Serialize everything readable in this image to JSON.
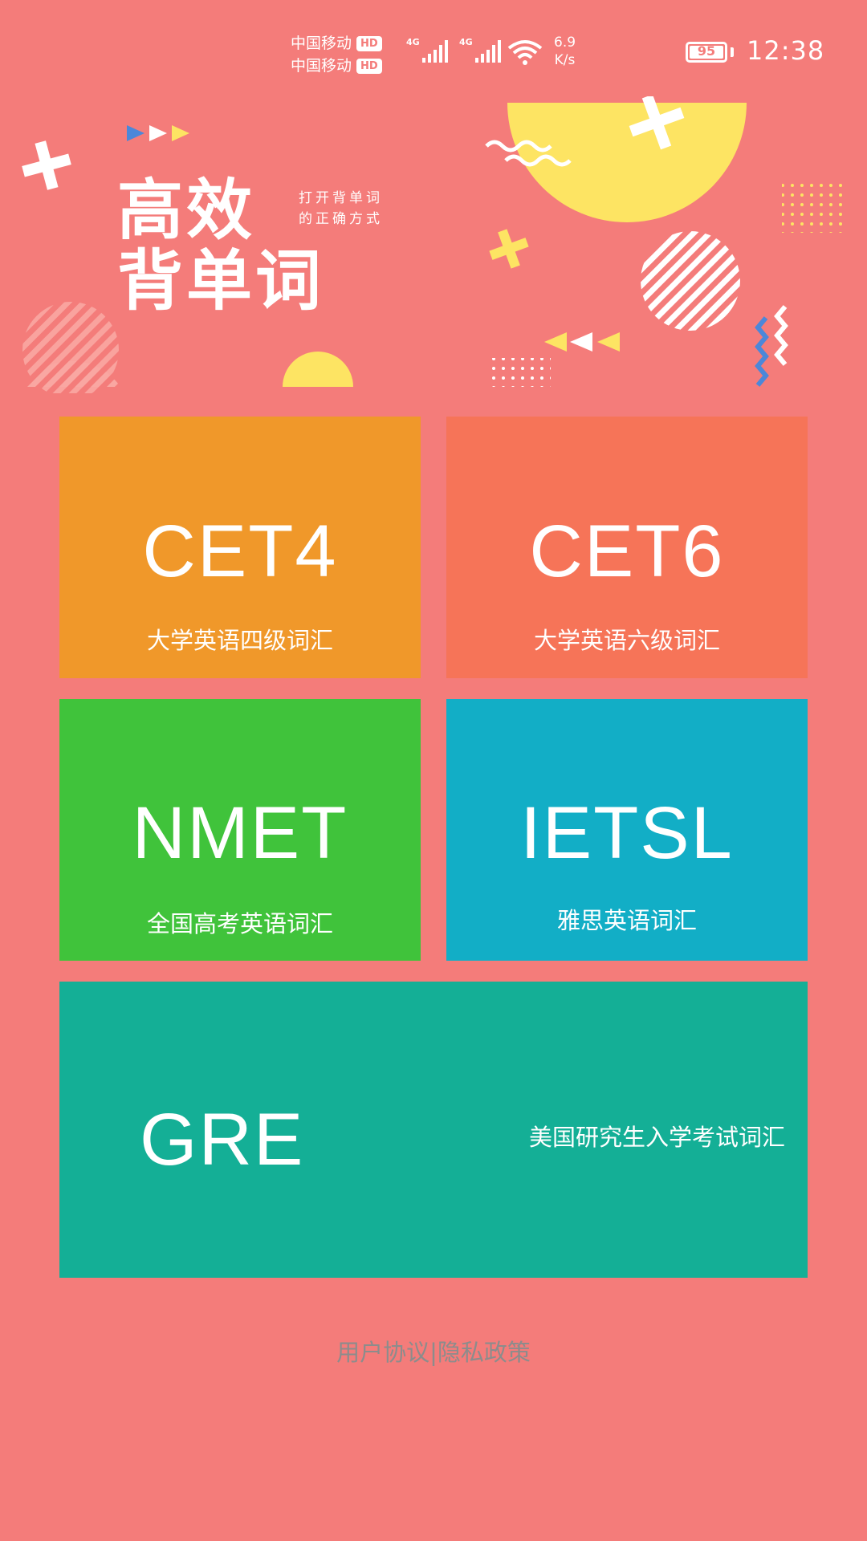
{
  "status_bar": {
    "carrier1": "中国移动",
    "carrier2": "中国移动",
    "hd_badge": "HD",
    "network1": "4G",
    "network2": "4G",
    "speed_value": "6.9",
    "speed_unit": "K/s",
    "battery_level": "95",
    "time": "12:38",
    "icons": [
      "hd-icon",
      "signal-icon",
      "wifi-icon",
      "battery-icon"
    ]
  },
  "banner": {
    "title_line1": "高效",
    "title_line2": "背单词",
    "subtitle_line1": "打开背单词",
    "subtitle_line2": "的正确方式"
  },
  "tiles": [
    {
      "code": "CET4",
      "desc": "大学英语四级词汇",
      "color": "#F0982A"
    },
    {
      "code": "CET6",
      "desc": "大学英语六级词汇",
      "color": "#F67458"
    },
    {
      "code": "NMET",
      "desc": "全国高考英语词汇",
      "color": "#40C33B"
    },
    {
      "code": "IETSL",
      "desc": "雅思英语词汇",
      "color": "#12AEC6"
    },
    {
      "code": "GRE",
      "desc": "美国研究生入学考试词汇",
      "color": "#14AF96"
    }
  ],
  "footer": {
    "user_agreement": "用户协议",
    "separator": "|",
    "privacy_policy": "隐私政策"
  },
  "colors": {
    "background": "#F47C7A",
    "footer_text": "#8C8C8C",
    "banner_yellow": "#FDE463"
  }
}
